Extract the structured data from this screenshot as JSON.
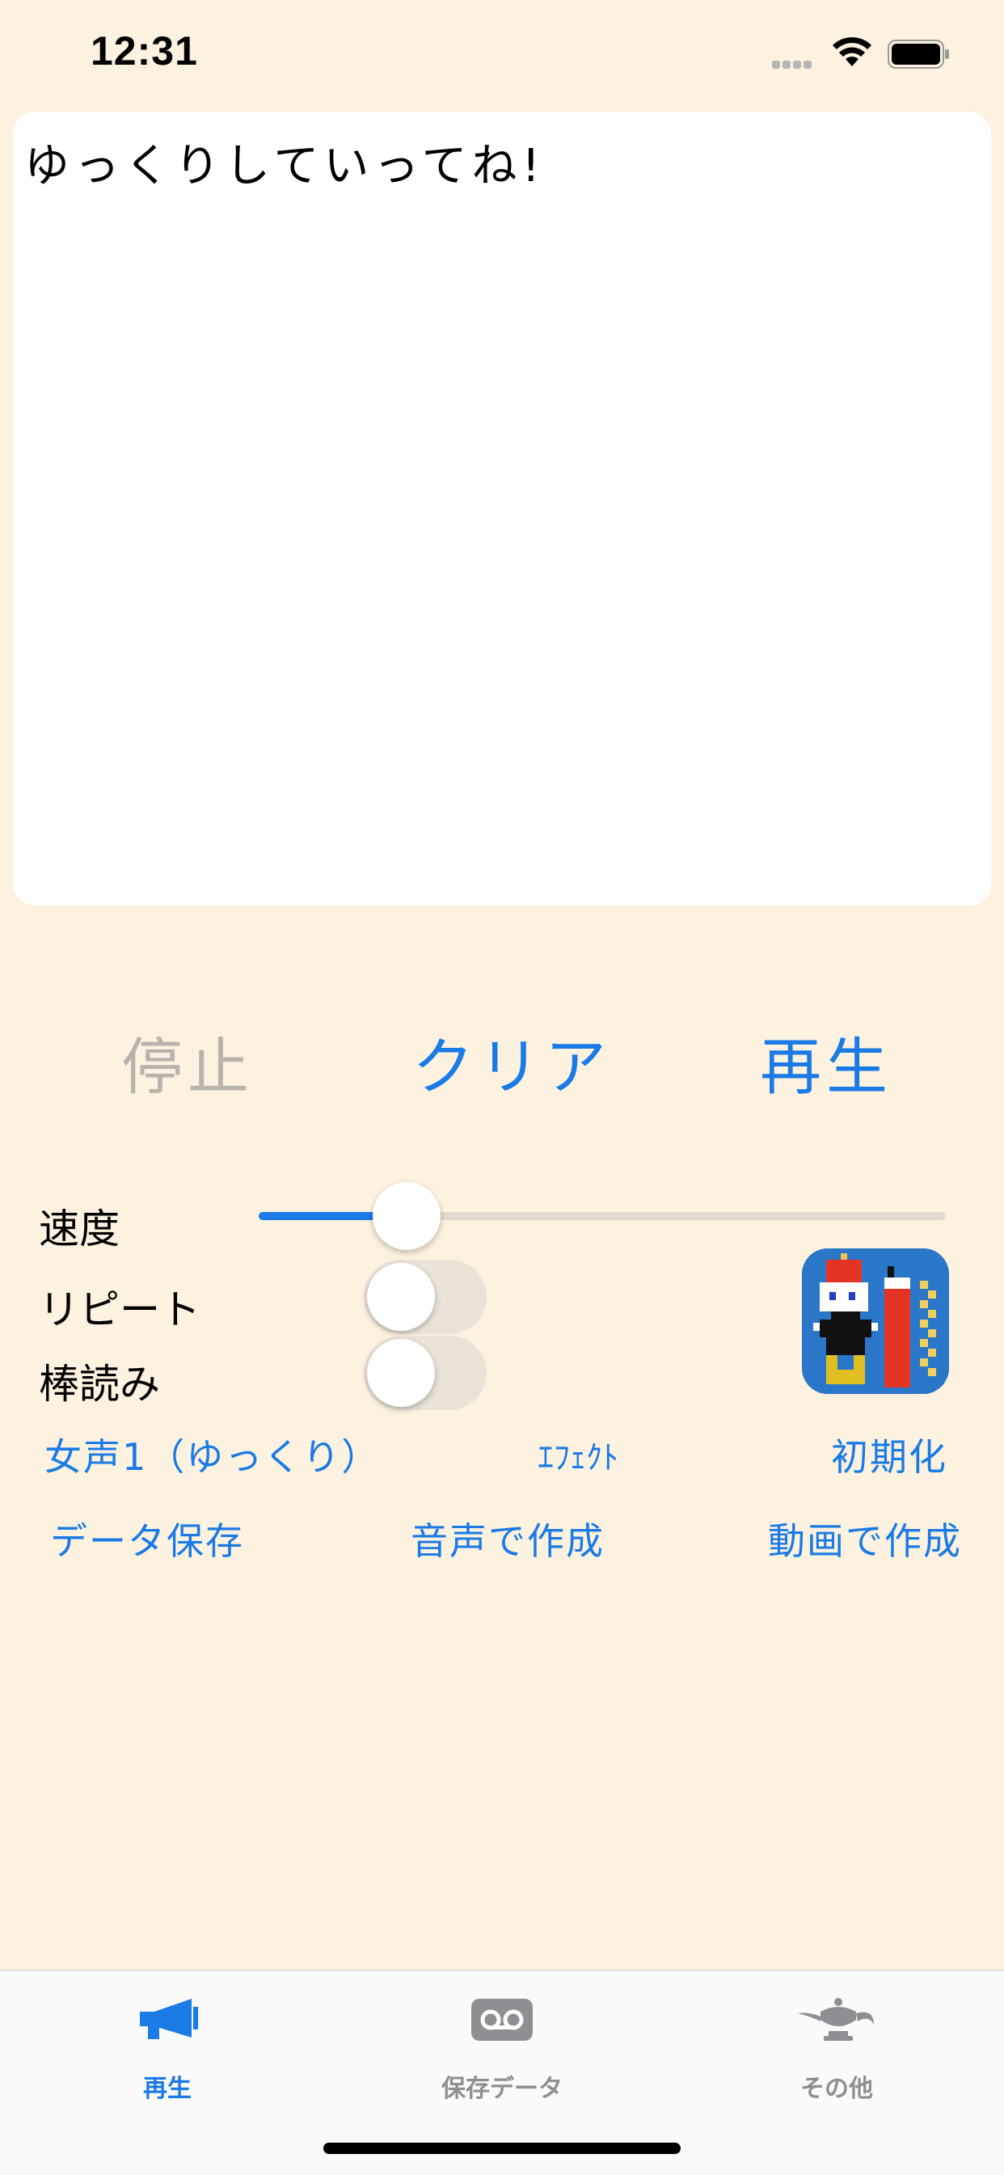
{
  "status": {
    "time": "12:31"
  },
  "editor": {
    "text": "ゆっくりしていってね!"
  },
  "controls": {
    "stop_label": "停止",
    "clear_label": "クリア",
    "play_label": "再生",
    "speed_label": "速度",
    "speed_value": 0.13,
    "repeat_label": "リピート",
    "repeat_on": false,
    "bouyomi_label": "棒読み",
    "bouyomi_on": false
  },
  "links": {
    "voice": "女声1（ゆっくり）",
    "effect": "ｴﾌｪｸﾄ",
    "reset": "初期化",
    "save_data": "データ保存",
    "make_audio": "音声で作成",
    "make_video": "動画で作成"
  },
  "tabs": [
    {
      "label": "再生",
      "icon": "megaphone-icon",
      "active": true
    },
    {
      "label": "保存データ",
      "icon": "voicemail-icon",
      "active": false
    },
    {
      "label": "その他",
      "icon": "magic-lamp-icon",
      "active": false
    }
  ],
  "colors": {
    "accent": "#1a7ae6",
    "background": "#fdf2e0",
    "disabled": "#b8b3ab",
    "inactive_tab": "#8e8e93"
  }
}
